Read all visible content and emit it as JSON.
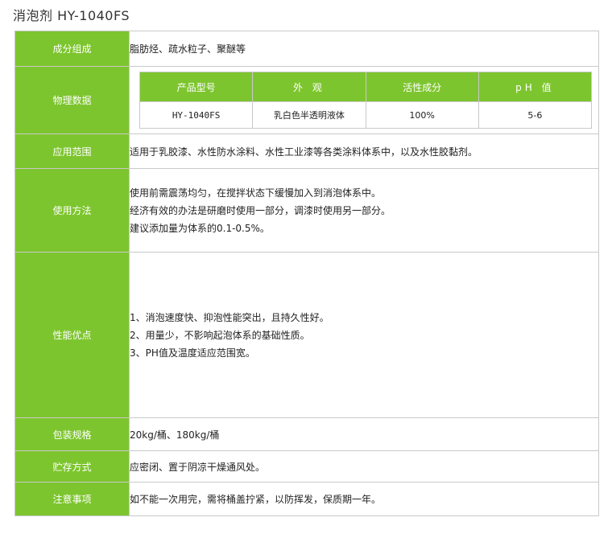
{
  "page": {
    "title": "消泡剂 HY-1040FS"
  },
  "rows": {
    "composition": {
      "label": "成分组成",
      "value": "脂肪烃、疏水粒子、聚醚等"
    },
    "physical": {
      "label": "物理数据",
      "headers": [
        "产品型号",
        "外 观",
        "活性成分",
        "pH 值"
      ],
      "values": [
        "HY-1040FS",
        "乳白色半透明液体",
        "100%",
        "5-6"
      ]
    },
    "scope": {
      "label": "应用范围",
      "value": "适用于乳胶漆、水性防水涂料、水性工业漆等各类涂料体系中，以及水性胶黏剂。"
    },
    "usage": {
      "label": "使用方法",
      "lines": [
        "使用前需震荡均匀，在搅拌状态下缓慢加入到消泡体系中。",
        "经济有效的办法是研磨时使用一部分，调漆时使用另一部分。",
        "建议添加量为体系的0.1-0.5%。"
      ]
    },
    "performance": {
      "label": "性能优点",
      "lines": [
        "1、消泡速度快、抑泡性能突出，且持久性好。",
        "2、用量少，不影响起泡体系的基础性质。",
        "3、PH值及温度适应范围宽。"
      ]
    },
    "packaging": {
      "label": "包装规格",
      "value": "20kg/桶、180kg/桶"
    },
    "storage": {
      "label": "贮存方式",
      "value": "应密闭、置于阴凉干燥通风处。"
    },
    "notes": {
      "label": "注意事项",
      "value": "如不能一次用完，需将桶盖拧紧，以防挥发，保质期一年。"
    }
  },
  "colors": {
    "label_background": "#7dc52e",
    "label_text": "#ffffff",
    "border": "#c9c9c9"
  }
}
